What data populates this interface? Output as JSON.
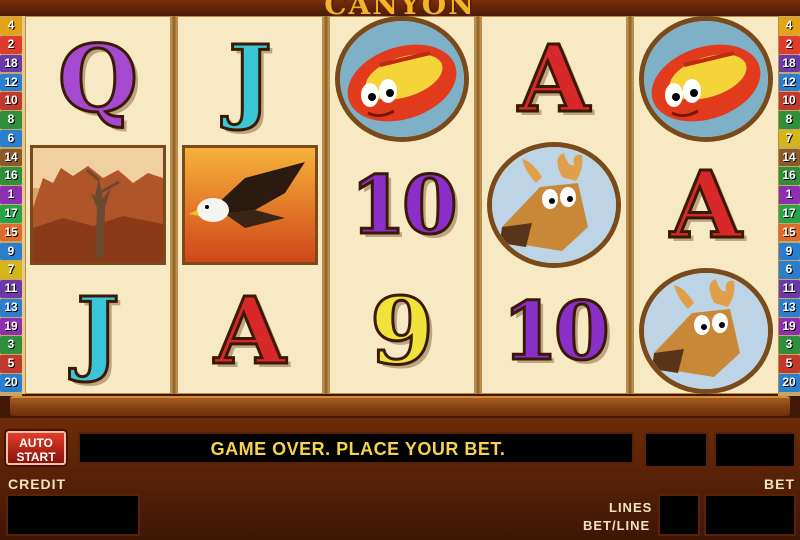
{
  "title": "CANYON",
  "paylines": {
    "left": [
      {
        "n": "4",
        "color": "#e2a316"
      },
      {
        "n": "2",
        "color": "#e03a2a"
      },
      {
        "n": "18",
        "color": "#6a3aa8"
      },
      {
        "n": "12",
        "color": "#2b7dcf"
      },
      {
        "n": "10",
        "color": "#c0392b"
      },
      {
        "n": "8",
        "color": "#2f8f3a"
      },
      {
        "n": "6",
        "color": "#2b7dcf"
      },
      {
        "n": "14",
        "color": "#8a5a2a"
      },
      {
        "n": "16",
        "color": "#2f8f3a"
      },
      {
        "n": "1",
        "color": "#8c2fb0"
      },
      {
        "n": "17",
        "color": "#27a34a"
      },
      {
        "n": "15",
        "color": "#e06a2a"
      },
      {
        "n": "9",
        "color": "#2b7dcf"
      },
      {
        "n": "7",
        "color": "#d4b51a"
      },
      {
        "n": "11",
        "color": "#6a3aa8"
      },
      {
        "n": "13",
        "color": "#2b7dcf"
      },
      {
        "n": "19",
        "color": "#8c2fb0"
      },
      {
        "n": "3",
        "color": "#2f8f3a"
      },
      {
        "n": "5",
        "color": "#c0392b"
      },
      {
        "n": "20",
        "color": "#2b7dcf"
      }
    ],
    "right": [
      {
        "n": "4",
        "color": "#e2a316"
      },
      {
        "n": "2",
        "color": "#e03a2a"
      },
      {
        "n": "18",
        "color": "#6a3aa8"
      },
      {
        "n": "12",
        "color": "#2b7dcf"
      },
      {
        "n": "10",
        "color": "#c0392b"
      },
      {
        "n": "8",
        "color": "#2f8f3a"
      },
      {
        "n": "7",
        "color": "#d4b51a"
      },
      {
        "n": "14",
        "color": "#8a5a2a"
      },
      {
        "n": "16",
        "color": "#2f8f3a"
      },
      {
        "n": "1",
        "color": "#8c2fb0"
      },
      {
        "n": "17",
        "color": "#27a34a"
      },
      {
        "n": "15",
        "color": "#e06a2a"
      },
      {
        "n": "9",
        "color": "#2b7dcf"
      },
      {
        "n": "6",
        "color": "#2b7dcf"
      },
      {
        "n": "11",
        "color": "#6a3aa8"
      },
      {
        "n": "13",
        "color": "#2b7dcf"
      },
      {
        "n": "19",
        "color": "#8c2fb0"
      },
      {
        "n": "3",
        "color": "#2f8f3a"
      },
      {
        "n": "5",
        "color": "#c0392b"
      },
      {
        "n": "20",
        "color": "#2b7dcf"
      }
    ]
  },
  "reels": [
    [
      {
        "type": "card",
        "text": "Q",
        "color": "#a54ad0"
      },
      {
        "type": "picture",
        "name": "canyon-landscape"
      },
      {
        "type": "card",
        "text": "J",
        "color": "#3bc6d8"
      }
    ],
    [
      {
        "type": "card",
        "text": "J",
        "color": "#3bc6d8"
      },
      {
        "type": "picture",
        "name": "eagle"
      },
      {
        "type": "card",
        "text": "A",
        "color": "#d8282a"
      }
    ],
    [
      {
        "type": "picture",
        "name": "raft"
      },
      {
        "type": "card",
        "text": "10",
        "color": "#8a2fc8"
      },
      {
        "type": "card",
        "text": "9",
        "color": "#f0e23a"
      }
    ],
    [
      {
        "type": "card",
        "text": "A",
        "color": "#d8282a"
      },
      {
        "type": "picture",
        "name": "moose"
      },
      {
        "type": "card",
        "text": "10",
        "color": "#8a2fc8"
      }
    ],
    [
      {
        "type": "picture",
        "name": "raft"
      },
      {
        "type": "card",
        "text": "A",
        "color": "#d8282a"
      },
      {
        "type": "picture",
        "name": "moose"
      }
    ]
  ],
  "console": {
    "auto_start_line1": "AUTO",
    "auto_start_line2": "START",
    "message": "GAME OVER. PLACE YOUR BET.",
    "credit_label": "CREDIT",
    "bet_label": "BET",
    "lines_label": "LINES",
    "bet_per_line_label": "BET/LINE"
  }
}
